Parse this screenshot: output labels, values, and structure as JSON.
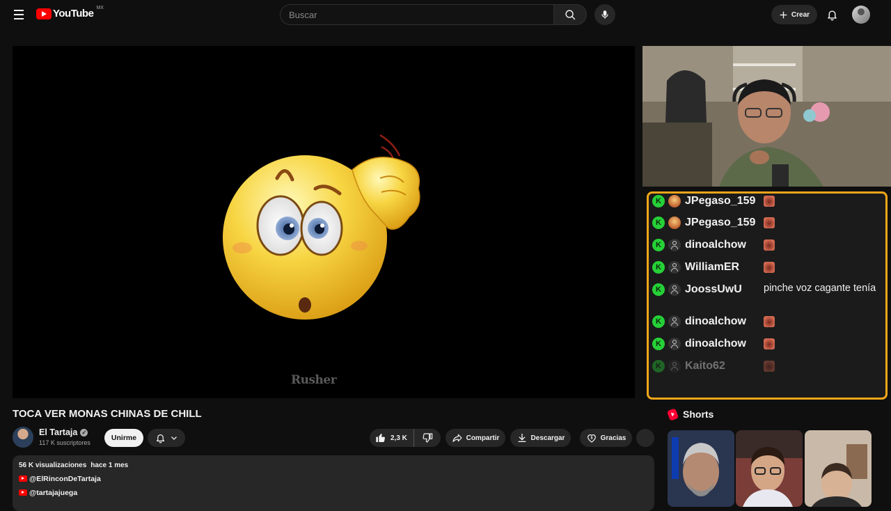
{
  "header": {
    "logo_text": "YouTube",
    "country_code": "MX",
    "search_placeholder": "Buscar",
    "create_label": "Crear"
  },
  "player": {
    "watermark": "Rusher"
  },
  "chat": {
    "border_color": "#f1a619",
    "messages": [
      {
        "badge": "K",
        "user": "JPegaso_159",
        "avatar": "picture",
        "content": "emote"
      },
      {
        "badge": "K",
        "user": "JPegaso_159",
        "avatar": "picture",
        "content": "emote"
      },
      {
        "badge": "K",
        "user": "dinoalchow",
        "avatar": "default",
        "content": "emote"
      },
      {
        "badge": "K",
        "user": "WilliamER",
        "avatar": "default",
        "content": "emote"
      },
      {
        "badge": "K",
        "user": "JoossUwU",
        "avatar": "default",
        "content": "pinche voz cagante tenía"
      },
      {
        "badge": "K",
        "user": "dinoalchow",
        "avatar": "default",
        "content": "emote"
      },
      {
        "badge": "K",
        "user": "dinoalchow",
        "avatar": "default",
        "content": "emote"
      },
      {
        "badge": "K",
        "user": "Kaito62",
        "avatar": "default",
        "content": "emote"
      }
    ]
  },
  "video": {
    "title": "TOCA VER MONAS CHINAS DE CHILL",
    "channel_name": "El Tartaja",
    "subscribers": "117 K suscriptores",
    "join_label": "Unirme",
    "likes": "2,3 K",
    "share_label": "Compartir",
    "download_label": "Descargar",
    "thanks_label": "Gracias"
  },
  "description": {
    "views": "56 K visualizaciones",
    "date": "hace 1 mes",
    "links": [
      "@ElRinconDeTartaja",
      "@tartajajuega"
    ]
  },
  "sidebar": {
    "shorts_label": "Shorts"
  }
}
